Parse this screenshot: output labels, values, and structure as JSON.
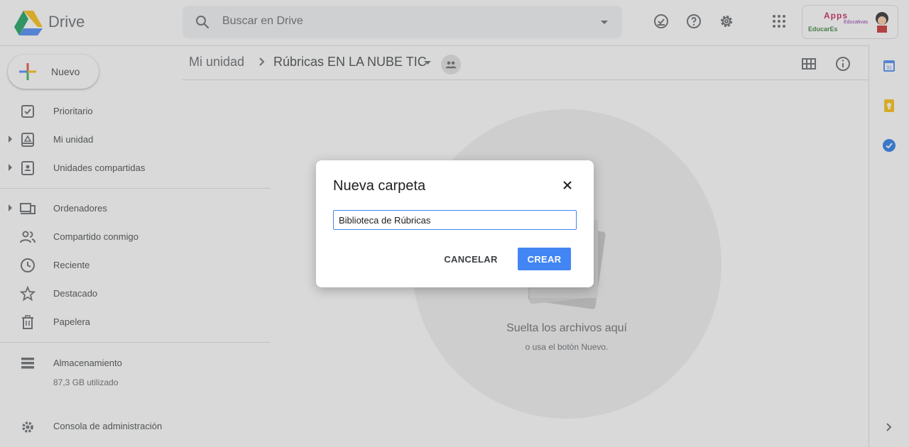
{
  "header": {
    "app_name": "Drive",
    "search": {
      "placeholder": "Buscar en Drive"
    },
    "icons": [
      "ready-for-offline-icon",
      "help-icon",
      "settings-icon",
      "apps-grid-icon"
    ],
    "profile": {
      "brand_text": "Apps",
      "brand_sub": "Educativas",
      "brand_name": "EducarEs"
    }
  },
  "sidebar": {
    "new_button": "Nuevo",
    "items": [
      {
        "label": "Prioritario",
        "icon": "priority-check-icon"
      },
      {
        "label": "Mi unidad",
        "icon": "my-drive-icon"
      },
      {
        "label": "Unidades compartidas",
        "icon": "shared-drives-icon"
      },
      {
        "label": "Ordenadores",
        "icon": "computers-icon"
      },
      {
        "label": "Compartido conmigo",
        "icon": "shared-with-me-icon"
      },
      {
        "label": "Reciente",
        "icon": "recent-clock-icon"
      },
      {
        "label": "Destacado",
        "icon": "star-icon"
      },
      {
        "label": "Papelera",
        "icon": "trash-icon"
      }
    ],
    "storage": {
      "label": "Almacenamiento",
      "used": "87,3 GB utilizado",
      "icon": "storage-icon"
    },
    "admin": {
      "label": "Consola de administración",
      "icon": "admin-console-icon"
    }
  },
  "breadcrumb": {
    "root": "Mi unidad",
    "current": "Rúbricas EN LA NUBE TIC"
  },
  "empty_state": {
    "title": "Suelta los archivos aquí",
    "subtitle": "o usa el botón Nuevo."
  },
  "side_panel": {
    "icons": [
      "calendar-icon",
      "keep-icon",
      "tasks-icon"
    ],
    "calendar_day": "31"
  },
  "dialog": {
    "title": "Nueva carpeta",
    "input_value": "Biblioteca de Rúbricas",
    "cancel_label": "CANCELAR",
    "create_label": "CREAR"
  },
  "colors": {
    "accent": "#4285f4",
    "scrim": "#808080"
  }
}
